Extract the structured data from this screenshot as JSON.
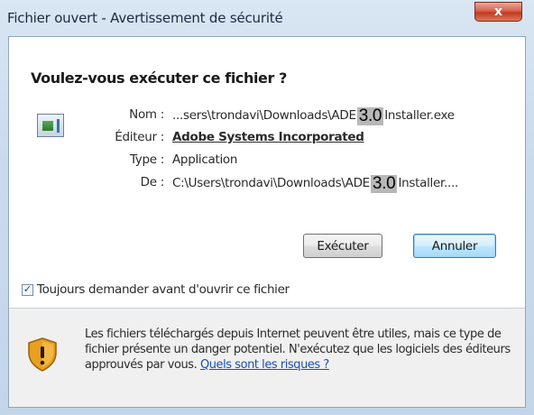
{
  "window": {
    "title": "Fichier ouvert - Avertissement de sécurité",
    "close_glyph": "x"
  },
  "dialog": {
    "heading": "Voulez-vous exécuter ce fichier ?",
    "file_icon": "application-file-icon",
    "fields": {
      "name": {
        "label": "Nom :",
        "value_prefix": "...sers\\trondavi\\Downloads\\ADE",
        "version": "3.0",
        "value_suffix": "Installer.exe"
      },
      "publisher": {
        "label": "Éditeur :",
        "value": "Adobe Systems Incorporated"
      },
      "type": {
        "label": "Type :",
        "value": "Application"
      },
      "from": {
        "label": "De :",
        "value_prefix": "C:\\Users\\trondavi\\Downloads\\ADE",
        "version": "3.0",
        "value_suffix": "Installer...."
      }
    },
    "buttons": {
      "run": "Exécuter",
      "cancel": "Annuler"
    },
    "always_ask": {
      "label": "Toujours demander avant d'ouvrir ce fichier",
      "checked": true,
      "check_glyph": "✓"
    },
    "warning": {
      "icon": "security-shield-icon",
      "text": "Les fichiers téléchargés depuis Internet peuvent être utiles, mais ce type de fichier présente un danger potentiel. N'exécutez que les logiciels des éditeurs approuvés par vous.",
      "link": "Quels sont les risques ?"
    }
  },
  "colors": {
    "link": "#1a4fb0",
    "shield_orange": "#e8a020",
    "close_red": "#c2391f"
  }
}
